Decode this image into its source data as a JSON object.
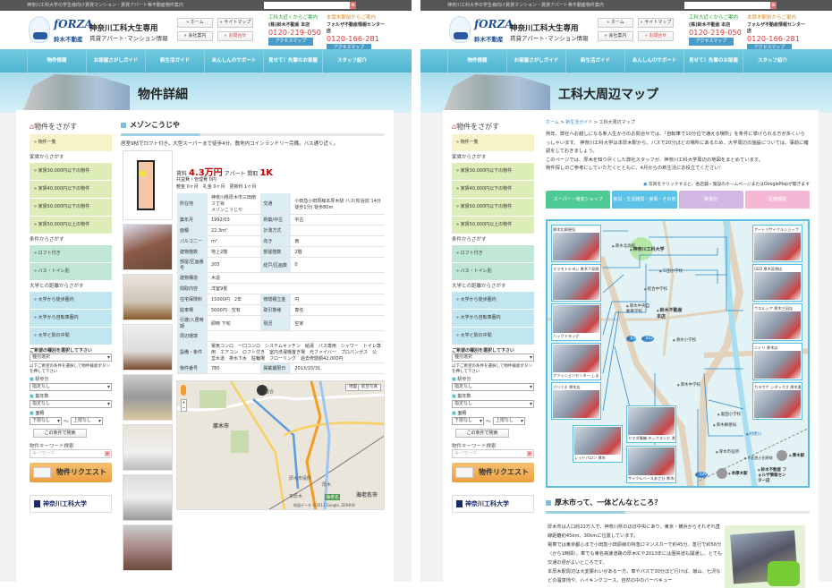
{
  "site": {
    "topbar_text": "神奈川工科大学の学生様向け賃貸マンション・賃貸アパート等不動産物件案内",
    "search_placeholder": "",
    "logo": {
      "brand": "fORZA",
      "sub": "鈴木不動産"
    },
    "title": "神奈川工科大生専用",
    "subtitle": "賃貸アパート･マンション情報",
    "header_buttons": [
      "» ホーム",
      "» サイトマップ",
      "» 会社案内",
      "» お問合せ"
    ],
    "contacts": [
      {
        "lead": "工科大近くからご案内",
        "store": "(株)鈴木不動産 本店",
        "phone": "0120-219-050",
        "button": "アクセスマップ"
      },
      {
        "lead": "本厚木駅前からご案内",
        "store": "フォルザ不動産情報センター店",
        "phone": "0120-166-281",
        "button": "アクセスマップ"
      }
    ],
    "nav": [
      "物件情報",
      "お部屋さがしガイド",
      "新生活ガイド",
      "あんしんのサポート",
      "見せて！先輩のお部屋",
      "スタッフ紹介"
    ],
    "sidebar": {
      "heading": "物件をさがす",
      "all": "» 物件一覧",
      "rent_heading": "家賃からさがす",
      "rent_items": [
        "» 家賃30,000円以下の物件",
        "» 家賃40,000円以下の物件",
        "» 家賃50,000円以下の物件",
        "» 家賃50,000円以上の物件"
      ],
      "cond_heading": "条件からさがす",
      "cond_items": [
        "» ロフト付き",
        "» バス・トイレ別"
      ],
      "dist_heading": "大学との距離からさがす",
      "dist_items": [
        "» 大学から徒歩圏内",
        "» 大学から自転車圏内",
        "» 大学と駅の中間"
      ],
      "type_prompt": "ご希望の種別を選択して下さい",
      "type_select": "種別選択",
      "cond_prompt": "以下ご希望の条件を選択して物件検索ボタンを押して下さい",
      "walk_label": "駅歩分",
      "walk_select": "指定なし",
      "age_label": "築年数",
      "age_select": "指定なし",
      "area_label": "面積",
      "area_min": "下限なし",
      "area_tilde": "〜",
      "area_max": "上限なし",
      "search_button": "この条件で検索",
      "keyword_label": "物件キーワード検索",
      "keyword_placeholder": "キーワード",
      "request_button": "物件リクエスト",
      "university_logo": "神奈川工科大学"
    }
  },
  "detail_page": {
    "banner_title": "物件詳細",
    "property_name": "メゾンこうじや",
    "description": "居室9帖でロフト付き。大型スーパーまで徒歩4分。敷地内コインランドリー完備。バス通り近く。",
    "rent_label": "賃料",
    "rent": "4.3万円",
    "type": "アパート",
    "layout_label": "間取",
    "layout": "1K",
    "fees": "共益費・管理費 0円",
    "deposits": "敷金 0ヶ月　礼金 0ヶ月　更新料 1ヶ月",
    "spec_rows": [
      [
        "所在地",
        "神奈川県厚木市三田南３丁目\nメゾンこうじや",
        "交通",
        "小田急小田原線本厚木駅 バス(松谷前 14分 徒歩1分) 徒歩80m"
      ],
      [
        "築年月",
        "1992/03",
        "新築/中古",
        "中古"
      ],
      [
        "面積",
        "22.3m²",
        "計測方式",
        ""
      ],
      [
        "バルコニー",
        "m²",
        "向き",
        "南"
      ],
      [
        "建物階数",
        "地上2階",
        "部屋階数",
        "2階"
      ],
      [
        "部屋/区画番号",
        "205",
        "総戸/区画数",
        "0"
      ],
      [
        "建物構造",
        "木造"
      ],
      [
        "間取内容",
        "洋室9畳"
      ],
      [
        "住宅保険料",
        "15000円　2年",
        "修繕積立金",
        "円"
      ],
      [
        "駐車場",
        "5000円　空有",
        "取引態様",
        "専任"
      ],
      [
        "引渡/入居時期",
        "即時 下旬",
        "現況",
        "空家"
      ],
      [
        "周辺環境",
        ""
      ],
      [
        "設備・条件",
        "電気コンロ　一口コンロ　システムキッチン　給湯　バス専用　シャワー　トイレ専用　エアコン　ロフト付き　室内洗濯機置き場　光ファイバー　プロパンガス　公営水道　排水下水　駐輪場　フローリング　過去修繕額42,000円"
      ],
      [
        "物件番号",
        "780",
        "掲載期限日",
        "2013/10/31"
      ]
    ],
    "map": {
      "btn_map": "地図",
      "btn_sat": "航空写真",
      "labels": [
        "厚木市",
        "海老名市",
        "厚木",
        "本厚木",
        "海老名",
        "厚木市役所",
        "睦合",
        "地図データ ©2013 Google, ZENRIN"
      ]
    }
  },
  "map_page": {
    "banner_title": "工科大周辺マップ",
    "breadcrumb": {
      "home": "ホーム",
      "guide": "新生活ガイド",
      "current": "工科大周辺マップ",
      "sep": " > "
    },
    "intro": [
      "例年、弊社へお越しになる新入生からのお問合せでは、「自転車で10分位で通える場所」を条件に挙げられる方が多くいらっしゃいます。 神奈川工科大学は本厚木駅から、バスで20分ほどの場所にあるため、大学周辺の施設については、事前に確認をしておきましょう。",
      "このページでは、厚木を知り尽くした弊社スタッフが、神奈川工科大学周辺の地図をまとめています。",
      "物件探しのご参考にしていただくとともに、4月からの新生活にお役立てください！"
    ],
    "note": "写真をクリックすると、各店舗・施設のホームページまたはGoogleMapが開きます",
    "tabs": [
      {
        "label": "スーパー・格安ショップ",
        "color": "#4ecb95"
      },
      {
        "label": "家具・生活雑貨・家電・その他",
        "color": "#5cc2e8"
      },
      {
        "label": "飲食店",
        "color": "#d3b8e4"
      },
      {
        "label": "医療機関",
        "color": "#f4b8d4"
      }
    ],
    "shops_left": [
      "厚木北郵便局",
      "マツモトキヨシ 厚木下荻野店",
      "ハックドラッグ",
      "ファッションセンター しまむら 荻野店",
      "パリミキ 厚木店",
      "レッドバロン 厚木"
    ],
    "shops_bottom": [
      "ヤマダ電機 テックランド 厚木店",
      "サイクルベースあさひ 厚木店"
    ],
    "shops_right": [
      "アートリサイクルショップ",
      "GEO 厚木荻野店",
      "ウエルシア 厚木三田店",
      "ニトリ 厚木店",
      "カラオケ シダックス 厚木妻田クラブ"
    ],
    "poi": {
      "university": "神奈川工科大学",
      "north_high": "厚木北高校",
      "mita": "三田小学校",
      "mutsuai": "睦合中学校",
      "driving": "厚木中央自動車学校",
      "honten": "鈴木不動産本店",
      "shimizu": "清水小学校",
      "atsugi_jh": "厚木中学校",
      "tsumada": "妻田小学校",
      "post": "厚木郵便局",
      "cityhall": "厚木市役所",
      "odakyu": "小田急小田原線",
      "hon_atsugi": "本厚木駅",
      "atsugi": "厚木駅",
      "forza": "鈴木不動産 フォルザ情報センター店",
      "river": "相模川",
      "r412": "412",
      "r129": "129",
      "r63": "63"
    },
    "section_title": "厚木市って、一体どんなところ？",
    "section_body": [
      "厚木市は人口約22万人で、神奈川県のほぼ中央にあり、東京・横浜からそれぞれ直線距離約45km、30kmに位置しています。",
      "電車では東京都心まで小田急小田原線の特急ロマンスカーで約45分、急行で約56分（から1時間）。車でも東名高速道路の厚木ICや2013年には圏央道も開通し、とても交通の便がよいところです。",
      "本厚木駅周辺は大変賑わいがある一方、車やバスで30分ほど行けば、飯山、七沢などの温泉地や、ハイキングコース、自然の中のバーベキュー"
    ]
  }
}
